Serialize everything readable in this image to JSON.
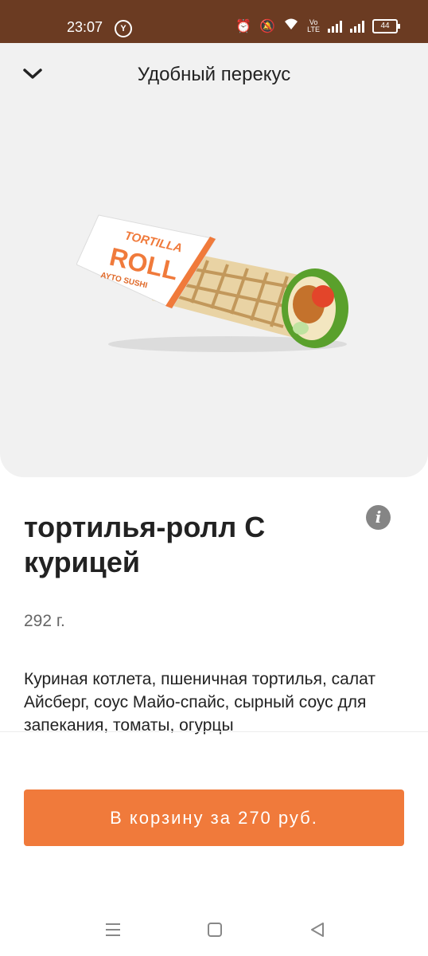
{
  "status_bar": {
    "time": "23:07",
    "y_label": "Y",
    "volte_top": "Vo",
    "volte_bottom": "LTE",
    "battery": "44"
  },
  "header": {
    "title": "Удобный перекус",
    "collapse_icon": "chevron-down-icon"
  },
  "product": {
    "image_text": {
      "line1": "TORTILLA",
      "line2": "ROLL",
      "brand": "AYTO SUSHI"
    },
    "name": "тортилья-ролл С курицей",
    "weight": "292 г.",
    "description": "Куриная котлета, пшеничная тортилья, салат Айсберг, соус Майо-спайс, сырный соус для запекания, томаты, огурцы",
    "info_icon": "info-icon"
  },
  "cart": {
    "label": "В корзину за 270 руб."
  },
  "nav": {
    "menu_icon": "menu-icon",
    "home_icon": "home-icon",
    "back_icon": "back-icon"
  },
  "colors": {
    "accent": "#f07a3b",
    "status_bar": "#6b3b22",
    "hero_bg": "#f1f1f1"
  }
}
